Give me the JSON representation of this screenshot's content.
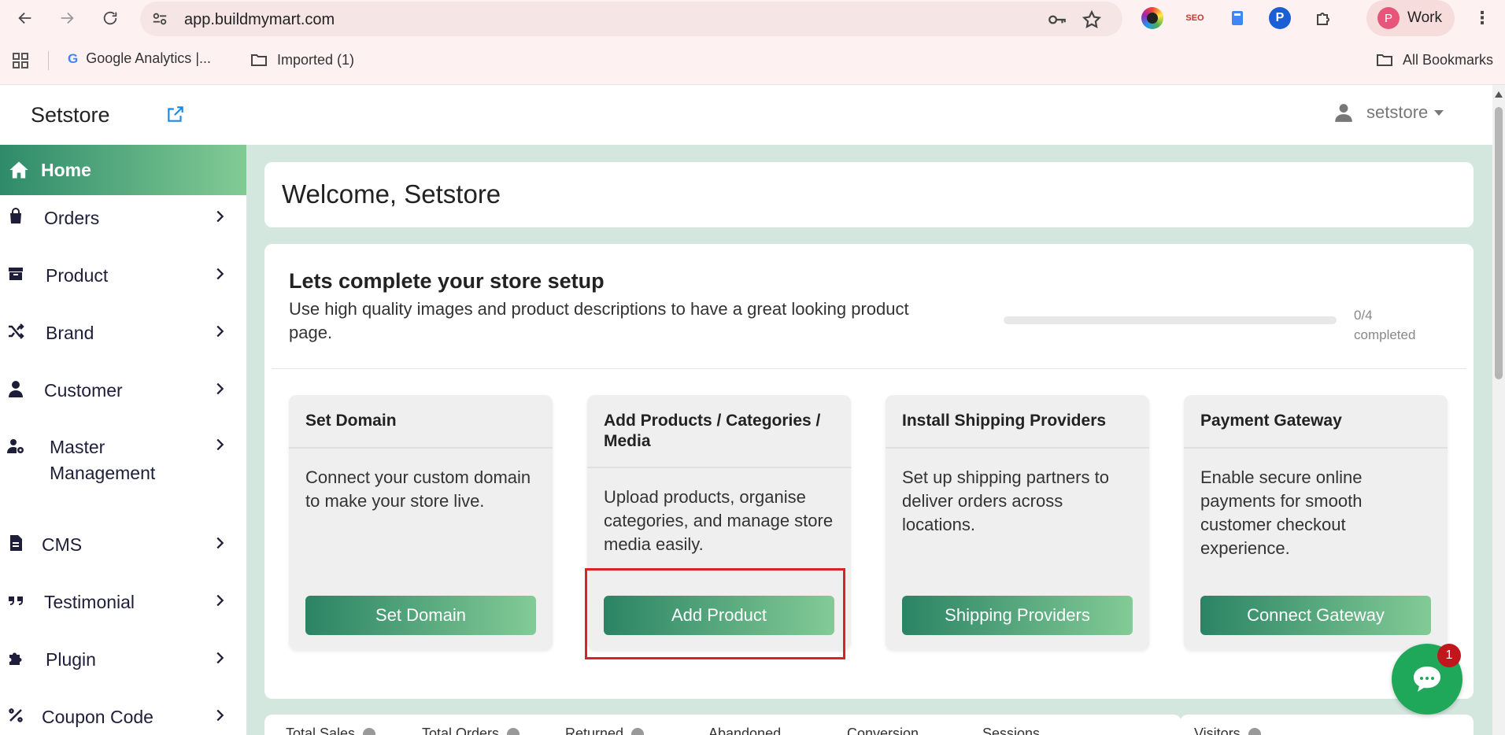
{
  "browser": {
    "url": "app.buildmymart.com",
    "profile_initial": "P",
    "profile_name": "Work",
    "extensions": [
      {
        "name": "color-picker-icon",
        "color": "#7c4dff"
      },
      {
        "name": "seo-icon",
        "label": "SEO",
        "color": "#d32f2f"
      },
      {
        "name": "clipboard-icon",
        "color": "#4285f4"
      },
      {
        "name": "p-extension-icon",
        "label": "P",
        "color": "#1a5fd6"
      },
      {
        "name": "puzzle-icon"
      }
    ],
    "bookmarks": [
      {
        "label": "Google Analytics  |..."
      },
      {
        "label": "Imported (1)"
      }
    ],
    "all_bookmarks": "All Bookmarks"
  },
  "header": {
    "brand": "Setstore",
    "username": "setstore"
  },
  "sidebar": {
    "home": "Home",
    "items": [
      {
        "label": "Orders",
        "icon": "shopping-bag-icon"
      },
      {
        "label": "Product",
        "icon": "archive-box-icon"
      },
      {
        "label": "Brand",
        "icon": "shuffle-icon"
      },
      {
        "label": "Customer",
        "icon": "user-icon"
      },
      {
        "label": "Master\nManagement",
        "icon": "user-gear-icon"
      },
      {
        "label": "CMS",
        "icon": "document-icon"
      },
      {
        "label": "Testimonial",
        "icon": "quote-icon"
      },
      {
        "label": "Plugin",
        "icon": "puzzle-piece-icon"
      },
      {
        "label": "Coupon Code",
        "icon": "percent-icon"
      }
    ]
  },
  "main": {
    "welcome": "Welcome, Setstore",
    "setup": {
      "title": "Lets complete your store setup",
      "description": "Use high quality images and product descriptions to have a great looking product page.",
      "progress_fraction": 0,
      "progress_count": "0/4",
      "progress_label": "completed",
      "tasks": [
        {
          "title": "Set Domain",
          "description": "Connect your custom domain to make your store live.",
          "button": "Set Domain"
        },
        {
          "title": "Add Products / Categories / Media",
          "description": "Upload products, organise categories, and manage store media easily.",
          "button": "Add Product"
        },
        {
          "title": "Install Shipping Providers",
          "description": "Set up shipping partners to deliver orders across locations.",
          "button": "Shipping Providers"
        },
        {
          "title": "Payment Gateway",
          "description": "Enable secure online payments for smooth customer checkout experience.",
          "button": "Connect Gateway"
        }
      ]
    },
    "stats": [
      "Total Sales",
      "Total Orders",
      "Returned",
      "Abandoned",
      "Conversion",
      "Sessions"
    ],
    "visitors": "Visitors"
  },
  "chat": {
    "badge": "1"
  },
  "colors": {
    "accent_start": "#2a8464",
    "accent_end": "#83cb96",
    "main_bg": "#d3e7df",
    "highlight": "#d8232a"
  }
}
